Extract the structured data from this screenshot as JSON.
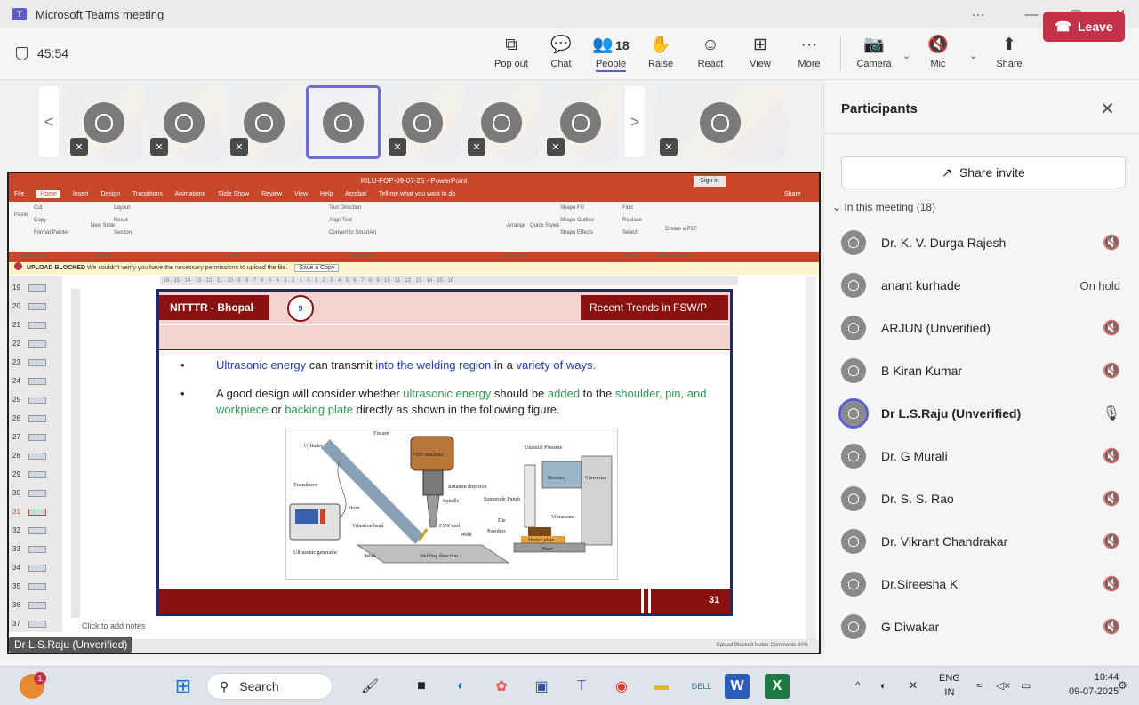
{
  "window": {
    "title": "Microsoft Teams meeting",
    "min": "—",
    "max": "▢",
    "close": "✕",
    "more": "···"
  },
  "meeting": {
    "timer": "45:54",
    "toolbar": [
      {
        "id": "popout",
        "label": "Pop out",
        "icon": "⧉"
      },
      {
        "id": "chat",
        "label": "Chat",
        "icon": "💬"
      },
      {
        "id": "people",
        "label": "People",
        "icon": "👥",
        "count": "18"
      },
      {
        "id": "raise",
        "label": "Raise",
        "icon": "✋"
      },
      {
        "id": "react",
        "label": "React",
        "icon": "☺"
      },
      {
        "id": "view",
        "label": "View",
        "icon": "⊞"
      },
      {
        "id": "more",
        "label": "More",
        "icon": "···"
      }
    ],
    "camera": {
      "label": "Camera",
      "icon": "📷"
    },
    "mic": {
      "label": "Mic",
      "icon": "🔇"
    },
    "share": {
      "label": "Share",
      "icon": "⬆"
    },
    "leave": {
      "label": "Leave",
      "icon": "☎"
    }
  },
  "stage": {
    "prev_arrow": "<",
    "next_arrow": ">",
    "speaker_tag": "Dr L.S.Raju (Unverified)"
  },
  "powerpoint": {
    "title": "KILU-FOP-09-07-25 - PowerPoint",
    "signin": "Sign in",
    "tabs": [
      "File",
      "Home",
      "Insert",
      "Design",
      "Transitions",
      "Animations",
      "Slide Show",
      "Review",
      "View",
      "Help",
      "Acrobat",
      "Tell me what you want to do"
    ],
    "share_tab": "Share",
    "groups": [
      "Clipboard",
      "Slides",
      "Font",
      "Paragraph",
      "Drawing",
      "Editing",
      "Adobe Acrobat"
    ],
    "ribbon_items": {
      "paste": "Paste",
      "cut": "Cut",
      "copy": "Copy",
      "format_painter": "Format Painter",
      "new_slide": "New Slide",
      "layout": "Layout",
      "reset": "Reset",
      "section": "Section",
      "text_direction": "Text Direction",
      "align_text": "Align Text",
      "smartart": "Convert to SmartArt",
      "arrange": "Arrange",
      "quick_styles": "Quick Styles",
      "shape_fill": "Shape Fill",
      "shape_outline": "Shape Outline",
      "shape_effects": "Shape Effects",
      "find": "Find",
      "replace": "Replace",
      "select": "Select",
      "create_pdf": "Create a PDF"
    },
    "warning": {
      "label": "UPLOAD BLOCKED",
      "text": "We couldn't verify you have the necessary permissions to upload the file.",
      "button": "Save a Copy"
    },
    "ruler": "· 16 · 15 · 14 · 13 · 12 · 11 · 10 · 9 · 8 · 7 · 6 · 5 · 4 · 3 · 2 · 1 · 0 · 1 · 2 · 3 · 4 · 5 · 6 · 7 · 8 · 9 · 10 · 11 · 12 · 13 · 14 · 15 · 16 ·",
    "slide_numbers": [
      "19",
      "20",
      "21",
      "22",
      "23",
      "24",
      "25",
      "26",
      "27",
      "28",
      "29",
      "30",
      "31",
      "32",
      "33",
      "34",
      "35",
      "36",
      "37"
    ],
    "current_slide": "31",
    "notes_placeholder": "Click to add notes",
    "status": "Upload Blocked   Notes   Comments      60%"
  },
  "slide": {
    "org": "NITTTR - Bhopal",
    "topic": "Recent Trends in FSW/P",
    "logo_text": "9",
    "bullet1": {
      "a": "Ultrasonic energy",
      "b": " can transmit ",
      "c": "into the welding region",
      "d": " in a ",
      "e": "variety of ways."
    },
    "bullet2": {
      "a": "A good design will consider whether ",
      "b": "ultrasonic energy",
      "c": " should be ",
      "d": "added",
      "e": " to the ",
      "f": "shoulder, pin, and workpiece",
      "g": " or ",
      "h": "backing plate",
      "i": " directly as shown in the following figure."
    },
    "figure_labels": {
      "cylinder": "Cylinder",
      "fixture": "Fixture",
      "fsw_machine": "FSW machine",
      "transducer": "Transducer",
      "rotation": "Rotation direction",
      "spindle": "Spindle",
      "horn": "Horn",
      "vibration_head": "Vibration head",
      "fsw_tool": "FSW tool",
      "weld": "Weld",
      "generator": "Ultrasonic generator",
      "work": "Work",
      "welding_direction": "Welding direction",
      "uniaxial": "Uniaxial Pressure",
      "booster": "Booster",
      "converter": "Converter",
      "sonotrode": "Sonotrode Punch",
      "vibrations": "Vibrations",
      "die": "Die",
      "powders": "Powders",
      "heater": "Heater plate",
      "base": "Base"
    },
    "page_number": "31"
  },
  "participants": {
    "title": "Participants",
    "close": "✕",
    "invite_label": "Share invite",
    "section_label": "In this meeting (18)",
    "list": [
      {
        "name": "Dr. K. V. Durga Rajesh",
        "status": "muted"
      },
      {
        "name": "anant kurhade",
        "status": "On hold"
      },
      {
        "name": "ARJUN (Unverified)",
        "status": "muted"
      },
      {
        "name": "B Kiran Kumar",
        "status": "muted"
      },
      {
        "name": "Dr L.S.Raju (Unverified)",
        "status": "speaking"
      },
      {
        "name": "Dr. G Murali",
        "status": "muted"
      },
      {
        "name": "Dr. S. S. Rao",
        "status": "muted"
      },
      {
        "name": "Dr. Vikrant Chandrakar",
        "status": "muted"
      },
      {
        "name": "Dr.Sireesha K",
        "status": "muted"
      },
      {
        "name": "G Diwakar",
        "status": "muted"
      }
    ]
  },
  "taskbar": {
    "search_placeholder": "Search",
    "notification_count": "1",
    "language": {
      "line1": "ENG",
      "line2": "IN"
    },
    "time": "10:44",
    "date": "09-07-2025"
  },
  "colors": {
    "accent": "#5b5fc7",
    "leave": "#c4314b",
    "ppt_red": "#c8462a",
    "slide_maroon": "#8b1010"
  }
}
